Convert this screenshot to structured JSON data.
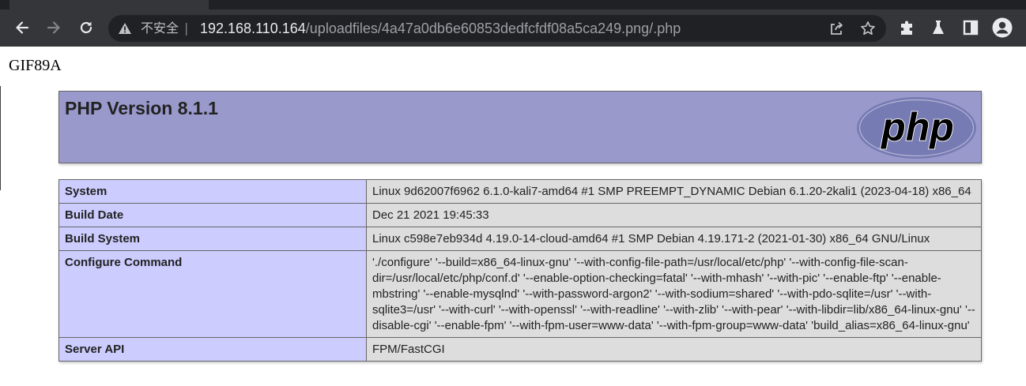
{
  "browser": {
    "address_bar": {
      "security_label": "不安全",
      "separator": "|",
      "url_host": "192.168.110.164",
      "url_path": "/uploadfiles/4a47a0db6e60853dedfcfdf08a5ca249.png/.php"
    },
    "icons": {
      "back": "back-arrow-icon",
      "forward": "forward-arrow-icon",
      "reload": "reload-icon",
      "warning": "warning-triangle-icon",
      "share": "share-icon",
      "bookmark": "star-icon",
      "extensions": "puzzle-icon",
      "labs": "flask-icon",
      "side_panel": "side-panel-icon",
      "profile": "profile-avatar-icon"
    }
  },
  "page": {
    "gif_header": "GIF89A",
    "php_version_title": "PHP Version 8.1.1",
    "logo_text": "php",
    "info_rows": [
      {
        "key": "System",
        "value": "Linux 9d62007f6962 6.1.0-kali7-amd64 #1 SMP PREEMPT_DYNAMIC Debian 6.1.20-2kali1 (2023-04-18) x86_64"
      },
      {
        "key": "Build Date",
        "value": "Dec 21 2021 19:45:33"
      },
      {
        "key": "Build System",
        "value": "Linux c598e7eb934d 4.19.0-14-cloud-amd64 #1 SMP Debian 4.19.171-2 (2021-01-30) x86_64 GNU/Linux"
      },
      {
        "key": "Configure Command",
        "value": "'./configure' '--build=x86_64-linux-gnu' '--with-config-file-path=/usr/local/etc/php' '--with-config-file-scan-dir=/usr/local/etc/php/conf.d' '--enable-option-checking=fatal' '--with-mhash' '--with-pic' '--enable-ftp' '--enable-mbstring' '--enable-mysqlnd' '--with-password-argon2' '--with-sodium=shared' '--with-pdo-sqlite=/usr' '--with-sqlite3=/usr' '--with-curl' '--with-openssl' '--with-readline' '--with-zlib' '--with-pear' '--with-libdir=lib/x86_64-linux-gnu' '--disable-cgi' '--enable-fpm' '--with-fpm-user=www-data' '--with-fpm-group=www-data' 'build_alias=x86_64-linux-gnu'"
      },
      {
        "key": "Server API",
        "value": "FPM/FastCGI"
      }
    ]
  },
  "colors": {
    "chrome_bg": "#35363a",
    "omnibox_bg": "#202124",
    "header_bg": "#9999cc",
    "key_cell_bg": "#ccccff",
    "value_cell_bg": "#dddddd",
    "border": "#666666",
    "logo_fill": "#777bb3"
  }
}
